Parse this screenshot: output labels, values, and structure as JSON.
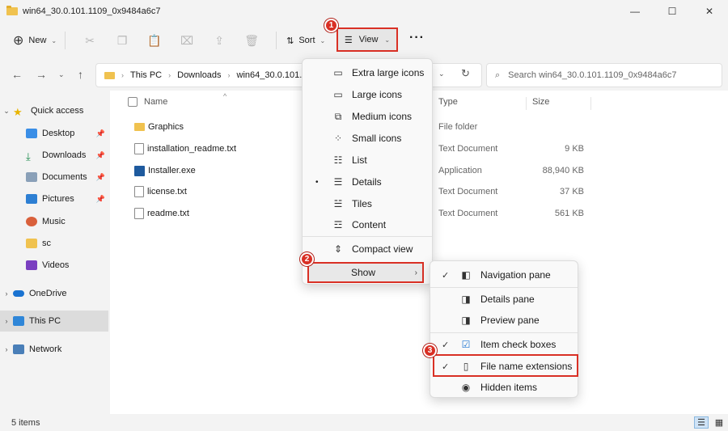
{
  "window": {
    "title": "win64_30.0.101.1109_0x9484a6c7",
    "minimize": "—",
    "maximize": "☐",
    "close": "✕"
  },
  "toolbar": {
    "new_label": "New",
    "sort_label": "Sort",
    "view_label": "View",
    "more_label": "···"
  },
  "address": {
    "crumbs": [
      "This PC",
      "Downloads",
      "win64_30.0.101.1109"
    ],
    "search_placeholder": "Search win64_30.0.101.1109_0x9484a6c7"
  },
  "sidebar": {
    "items": [
      {
        "label": "Quick access"
      },
      {
        "label": "Desktop"
      },
      {
        "label": "Downloads"
      },
      {
        "label": "Documents"
      },
      {
        "label": "Pictures"
      },
      {
        "label": "Music"
      },
      {
        "label": "sc"
      },
      {
        "label": "Videos"
      },
      {
        "label": "OneDrive"
      },
      {
        "label": "This PC"
      },
      {
        "label": "Network"
      }
    ]
  },
  "columns": {
    "name": "Name",
    "type": "Type",
    "size": "Size"
  },
  "files": [
    {
      "name": "Graphics",
      "type": "File folder",
      "size": ""
    },
    {
      "name": "installation_readme.txt",
      "type": "Text Document",
      "size": "9 KB"
    },
    {
      "name": "Installer.exe",
      "type": "Application",
      "size": "88,940 KB"
    },
    {
      "name": "license.txt",
      "type": "Text Document",
      "size": "37 KB"
    },
    {
      "name": "readme.txt",
      "type": "Text Document",
      "size": "561 KB"
    }
  ],
  "status": {
    "item_count": "5 items"
  },
  "view_menu": {
    "items": [
      {
        "label": "Extra large icons"
      },
      {
        "label": "Large icons"
      },
      {
        "label": "Medium icons"
      },
      {
        "label": "Small icons"
      },
      {
        "label": "List"
      },
      {
        "label": "Details"
      },
      {
        "label": "Tiles"
      },
      {
        "label": "Content"
      },
      {
        "label": "Compact view"
      }
    ],
    "show_label": "Show"
  },
  "show_menu": {
    "items": [
      {
        "label": "Navigation pane",
        "checked": true
      },
      {
        "label": "Details pane",
        "checked": false
      },
      {
        "label": "Preview pane",
        "checked": false
      },
      {
        "label": "Item check boxes",
        "checked": true
      },
      {
        "label": "File name extensions",
        "checked": true
      },
      {
        "label": "Hidden items",
        "checked": false
      }
    ]
  },
  "badges": [
    "1",
    "2",
    "3"
  ],
  "colors": {
    "highlight": "#d93025",
    "folder": "#f0c24f",
    "selection": "#dcdcdc"
  }
}
